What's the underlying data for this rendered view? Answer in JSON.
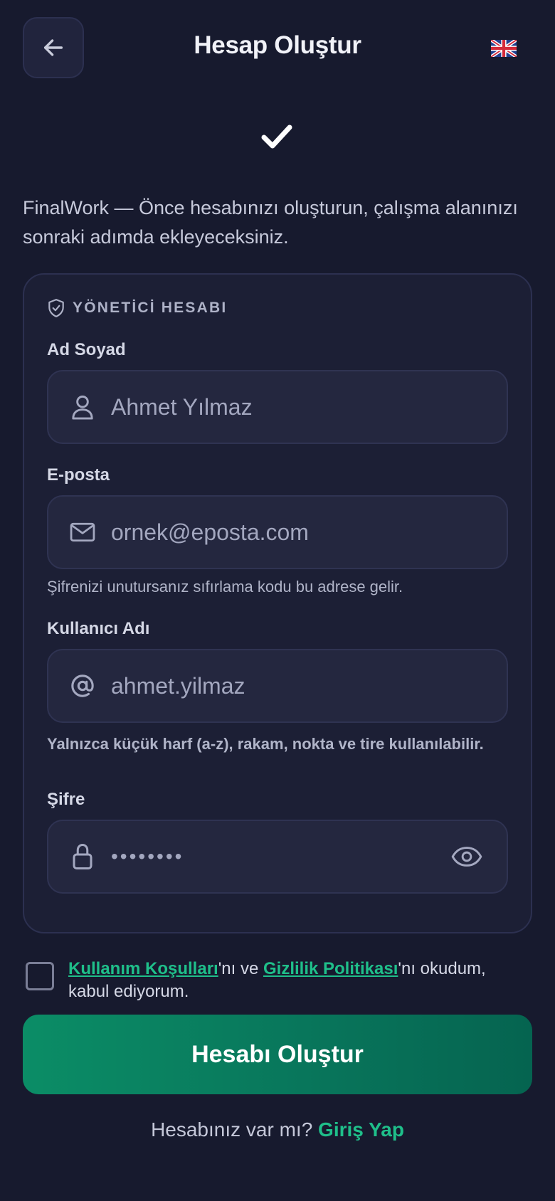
{
  "header": {
    "title": "Hesap Oluştur",
    "back_icon": "arrow-left-icon",
    "language_icon": "uk-flag-icon"
  },
  "intro": {
    "text": "FinalWork — Önce hesabınızı oluşturun, çalışma alanınızı sonraki adımda ekleyeceksiniz."
  },
  "form": {
    "section_title": "YÖNETİCİ HESABI",
    "full_name": {
      "label": "Ad Soyad",
      "placeholder": "Ahmet Yılmaz",
      "icon": "user-icon"
    },
    "email": {
      "label": "E-posta",
      "placeholder": "ornek@eposta.com",
      "icon": "mail-icon",
      "hint": "Şifrenizi unutursanız sıfırlama kodu bu adrese gelir."
    },
    "username": {
      "label": "Kullanıcı Adı",
      "placeholder": "ahmet.yilmaz",
      "icon": "at-icon",
      "hint": "Yalnızca küçük harf (a-z), rakam, nokta ve tire kullanılabilir."
    },
    "password": {
      "label": "Şifre",
      "value": "••••••••",
      "icon": "lock-icon",
      "toggle_icon": "eye-icon"
    }
  },
  "terms": {
    "link1": "Kullanım Koşulları",
    "text1": "'nı ve ",
    "link2": "Gizlilik Politikası",
    "text2": "'nı okudum, kabul ediyorum.",
    "checked": false
  },
  "submit": {
    "label": "Hesabı Oluştur"
  },
  "login": {
    "prompt": "Hesabınız var mı?",
    "link": "Giriş Yap"
  },
  "colors": {
    "background": "#171a2e",
    "card": "#1c1f35",
    "field": "#24273f",
    "accent": "#1fbf8a",
    "button": "#0b8d66"
  }
}
